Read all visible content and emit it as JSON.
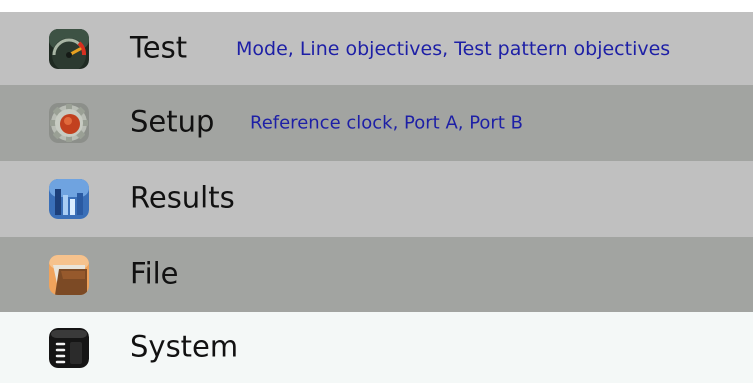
{
  "menu": {
    "items": [
      {
        "label": "Test",
        "subtitle": "Mode, Line objectives, Test pattern objectives",
        "icon": "gauge-icon"
      },
      {
        "label": "Setup",
        "subtitle": "Reference clock, Port A, Port B",
        "icon": "gear-icon"
      },
      {
        "label": "Results",
        "subtitle": "",
        "icon": "bar-chart-icon"
      },
      {
        "label": "File",
        "subtitle": "",
        "icon": "folder-icon"
      },
      {
        "label": "System",
        "subtitle": "",
        "icon": "system-icon"
      }
    ]
  },
  "colors": {
    "row_light": "#c0c0c0",
    "row_dark": "#a2a4a1",
    "row_selected": "#f4f8f7",
    "subtitle_text": "#1d1fa6",
    "label_text": "#111111"
  }
}
